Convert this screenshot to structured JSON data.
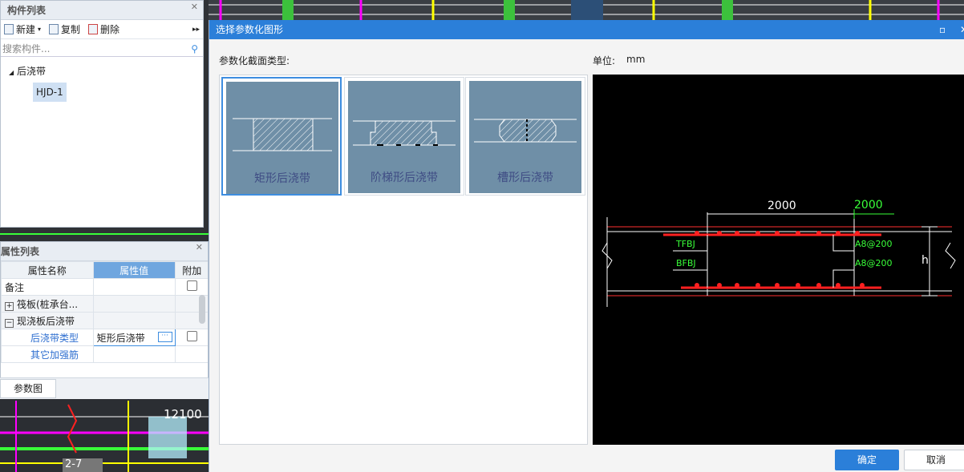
{
  "component_panel": {
    "title": "构件列表",
    "toolbar": {
      "new_label": "新建",
      "copy_label": "复制",
      "delete_label": "删除"
    },
    "search_placeholder": "搜索构件...",
    "tree": {
      "group": "后浇带",
      "item": "HJD-1"
    }
  },
  "property_panel": {
    "title": "属性列表",
    "headers": {
      "name": "属性名称",
      "value": "属性值",
      "extra": "附加"
    },
    "rows": [
      {
        "name": "备注",
        "value": ""
      },
      {
        "name": "筏板(桩承台...",
        "value": ""
      },
      {
        "name": "现浇板后浇带",
        "value": ""
      },
      {
        "name": "后浇带类型",
        "value": "矩形后浇带"
      },
      {
        "name": "其它加强筋",
        "value": ""
      }
    ],
    "param_tab": "参数图"
  },
  "background_cad": {
    "dimension_text": "12100",
    "axis_label": "2-7"
  },
  "dialog": {
    "title": "选择参数化图形",
    "section_label": "参数化截面类型:",
    "unit_label": "单位:",
    "unit_value": "mm",
    "shapes": [
      "矩形后浇带",
      "阶梯形后浇带",
      "槽形后浇带"
    ],
    "selected_shape": "矩形后浇带",
    "preview": {
      "dim_left": "2000",
      "dim_right": "2000",
      "top_rebar": "TFBJ",
      "bottom_rebar": "BFBJ",
      "add_top": "A8@200",
      "add_bottom": "A8@200",
      "height_label": "h"
    },
    "ok_label": "确定",
    "cancel_label": "取消"
  },
  "colors": {
    "accent": "#2b7fd9",
    "thumb_bg": "#6f8fa7",
    "rebar": "#ff2020",
    "cad_green": "#39ff39"
  }
}
